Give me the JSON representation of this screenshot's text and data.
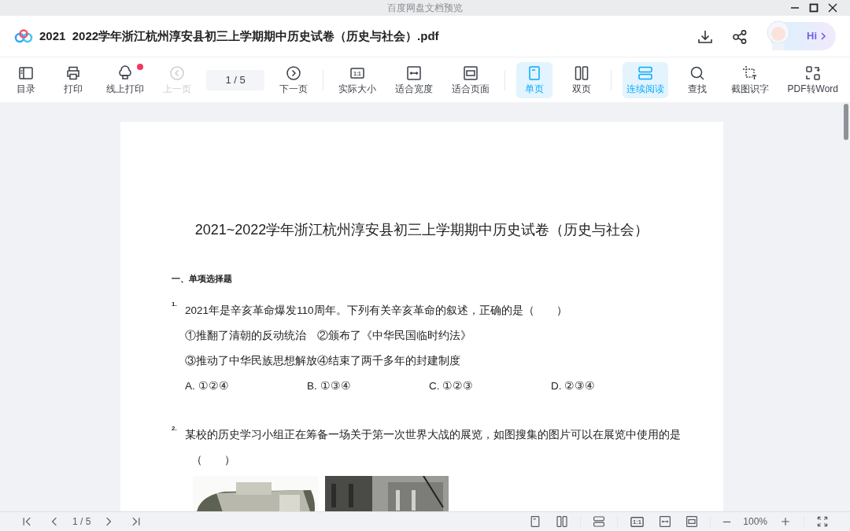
{
  "window": {
    "title": "百度网盘文档预览"
  },
  "header": {
    "file_name": "2021  2022学年浙江杭州淳安县初三上学期期中历史试卷（历史与社会）.pdf",
    "assistant_label": "Hi"
  },
  "toolbar": [
    {
      "kind": "toc",
      "label": "目录",
      "selected": false,
      "disabled": false,
      "notification": false
    },
    {
      "kind": "print",
      "label": "打印",
      "selected": false,
      "disabled": false,
      "notification": false
    },
    {
      "kind": "cloud-print",
      "label": "线上打印",
      "selected": false,
      "disabled": false,
      "notification": true
    },
    {
      "kind": "prev",
      "label": "上一页",
      "selected": false,
      "disabled": true,
      "notification": false
    },
    {
      "kind": "field",
      "value": "1 / 5"
    },
    {
      "kind": "next",
      "label": "下一页",
      "selected": false,
      "disabled": false,
      "notification": false
    },
    {
      "kind": "separator"
    },
    {
      "kind": "actual",
      "label": "实际大小",
      "icon_text": "1:1",
      "selected": false,
      "disabled": false,
      "notification": false
    },
    {
      "kind": "fit-width",
      "label": "适合宽度",
      "selected": false,
      "disabled": false,
      "notification": false
    },
    {
      "kind": "fit-page",
      "label": "适合页面",
      "selected": false,
      "disabled": false,
      "notification": false
    },
    {
      "kind": "separator"
    },
    {
      "kind": "single",
      "label": "单页",
      "selected": true,
      "disabled": false,
      "notification": false
    },
    {
      "kind": "double",
      "label": "双页",
      "selected": false,
      "disabled": false,
      "notification": false
    },
    {
      "kind": "separator"
    },
    {
      "kind": "continuous",
      "label": "连续阅读",
      "selected": true,
      "disabled": false,
      "notification": false
    },
    {
      "kind": "search",
      "label": "查找",
      "selected": false,
      "disabled": false,
      "notification": false
    },
    {
      "kind": "crop",
      "label": "截图识字",
      "selected": false,
      "disabled": false,
      "notification": false
    },
    {
      "kind": "convert",
      "label": "PDF转Word",
      "selected": false,
      "disabled": false,
      "notification": false
    }
  ],
  "document": {
    "title": "2021~2022学年浙江杭州淳安县初三上学期期中历史试卷（历史与社会）",
    "section": "一、单项选择题",
    "questions": [
      {
        "number": "1.",
        "lines": [
          "2021年是辛亥革命爆发110周年。下列有关辛亥革命的叙述，正确的是（　　）",
          "①推翻了清朝的反动统治　②颁布了《中华民国临时约法》",
          "③推动了中华民族思想解放④结束了两千多年的封建制度"
        ],
        "options": [
          "A. ①②④",
          "B. ①③④",
          "C. ①②③",
          "D. ②③④"
        ]
      },
      {
        "number": "2.",
        "lines": [
          "某校的历史学习小组正在筹备一场关于第一次世界大战的展览，如图搜集的图片可以在展览中使用的是",
          "（　　）"
        ],
        "pictures": [
          {
            "kind": "picture"
          },
          {
            "kind": "picture"
          }
        ]
      }
    ]
  },
  "status_bar": {
    "page": "1 / 5",
    "zoom": "100%",
    "left": [
      {
        "kind": "first"
      },
      {
        "kind": "prev"
      },
      {
        "kind": "page"
      },
      {
        "kind": "next"
      },
      {
        "kind": "last"
      }
    ],
    "right": [
      {
        "kind": "single"
      },
      {
        "kind": "double"
      },
      {
        "kind": "separator"
      },
      {
        "kind": "continuous"
      },
      {
        "kind": "separator"
      },
      {
        "kind": "actual",
        "icon_text": "1:1"
      },
      {
        "kind": "fit-width"
      },
      {
        "kind": "fit-page"
      },
      {
        "kind": "separator"
      },
      {
        "kind": "minus"
      },
      {
        "kind": "zoom"
      },
      {
        "kind": "plus"
      },
      {
        "kind": "separator"
      },
      {
        "kind": "fullscreen"
      }
    ]
  }
}
